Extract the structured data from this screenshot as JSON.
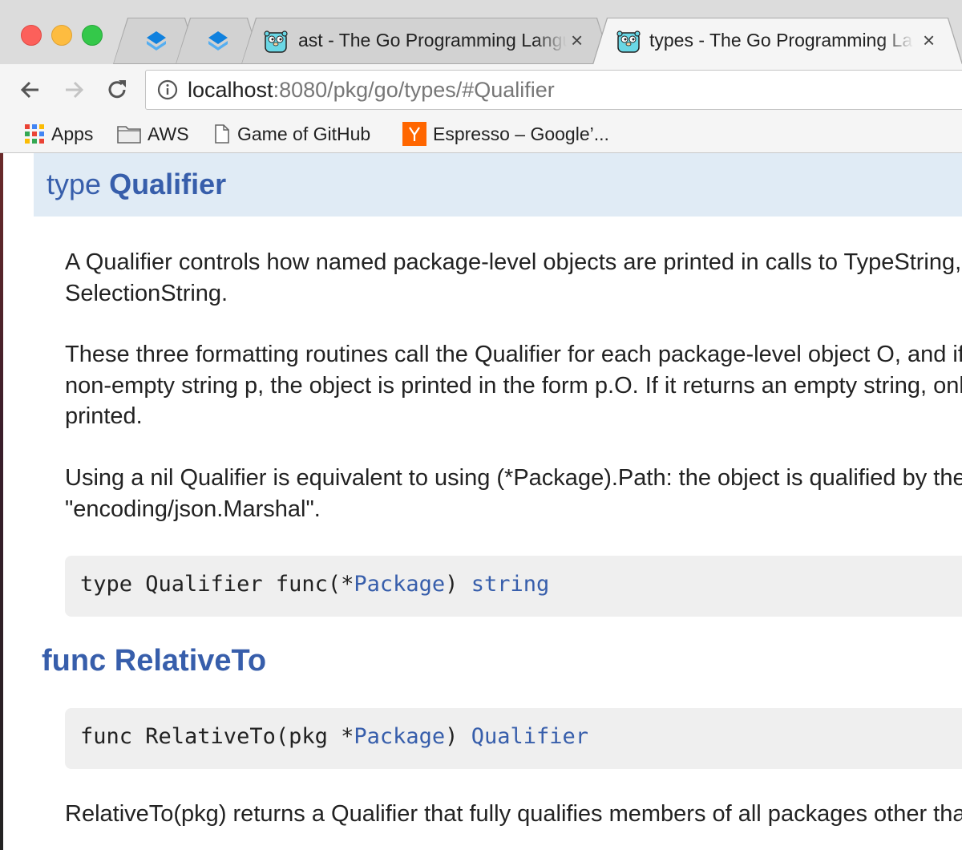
{
  "browser": {
    "tabs": [
      {
        "title": "",
        "icon": "dropbox-icon",
        "active": false
      },
      {
        "title": "",
        "icon": "dropbox-icon",
        "active": false
      },
      {
        "title": "ast - The Go Programming Language",
        "icon": "gopher-icon",
        "active": false,
        "close": "×"
      },
      {
        "title": "types - The Go Programming Language",
        "icon": "gopher-icon",
        "active": true,
        "close": "×"
      }
    ],
    "url_host": "localhost",
    "url_path": ":8080/pkg/go/types/#Qualifier",
    "bookmarks": [
      {
        "label": "Apps",
        "icon": "apps-grid-icon"
      },
      {
        "label": "AWS",
        "icon": "folder-icon"
      },
      {
        "label": "Game of GitHub",
        "icon": "page-icon"
      },
      {
        "label": "Espresso – Google’...",
        "icon": "y-combinator-icon"
      }
    ],
    "colors": {
      "accent": "#375eab",
      "header_bg": "#e0ebf5",
      "code_bg": "#efefef",
      "tab_active": "#f5f5f5"
    }
  },
  "doc": {
    "type_keyword": "type",
    "type_name": "Qualifier",
    "paragraphs": [
      [
        "A Qualifier controls how named package-level objects are printed in calls to TypeString, ObjectString, and",
        "SelectionString."
      ],
      [
        "These three formatting routines call the Qualifier for each package-level object O, and if the Qualifier returns a",
        "non-empty string p, the object is printed in the form p.O. If it returns an empty string, only the object name O is",
        "printed."
      ],
      [
        "Using a nil Qualifier is equivalent to using (*Package).Path: the object is qualified by the import path, e.g.,",
        "\"encoding/json.Marshal\"."
      ]
    ],
    "decl1": {
      "prefix": "type Qualifier func(*",
      "link1": "Package",
      "mid": ") ",
      "link2": "string"
    },
    "func_heading": "func RelativeTo",
    "decl2": {
      "prefix": "func RelativeTo(pkg *",
      "link1": "Package",
      "mid": ") ",
      "link2": "Qualifier"
    },
    "last_paragraph": "RelativeTo(pkg) returns a Qualifier that fully qualifies members of all packages other than pkg."
  }
}
